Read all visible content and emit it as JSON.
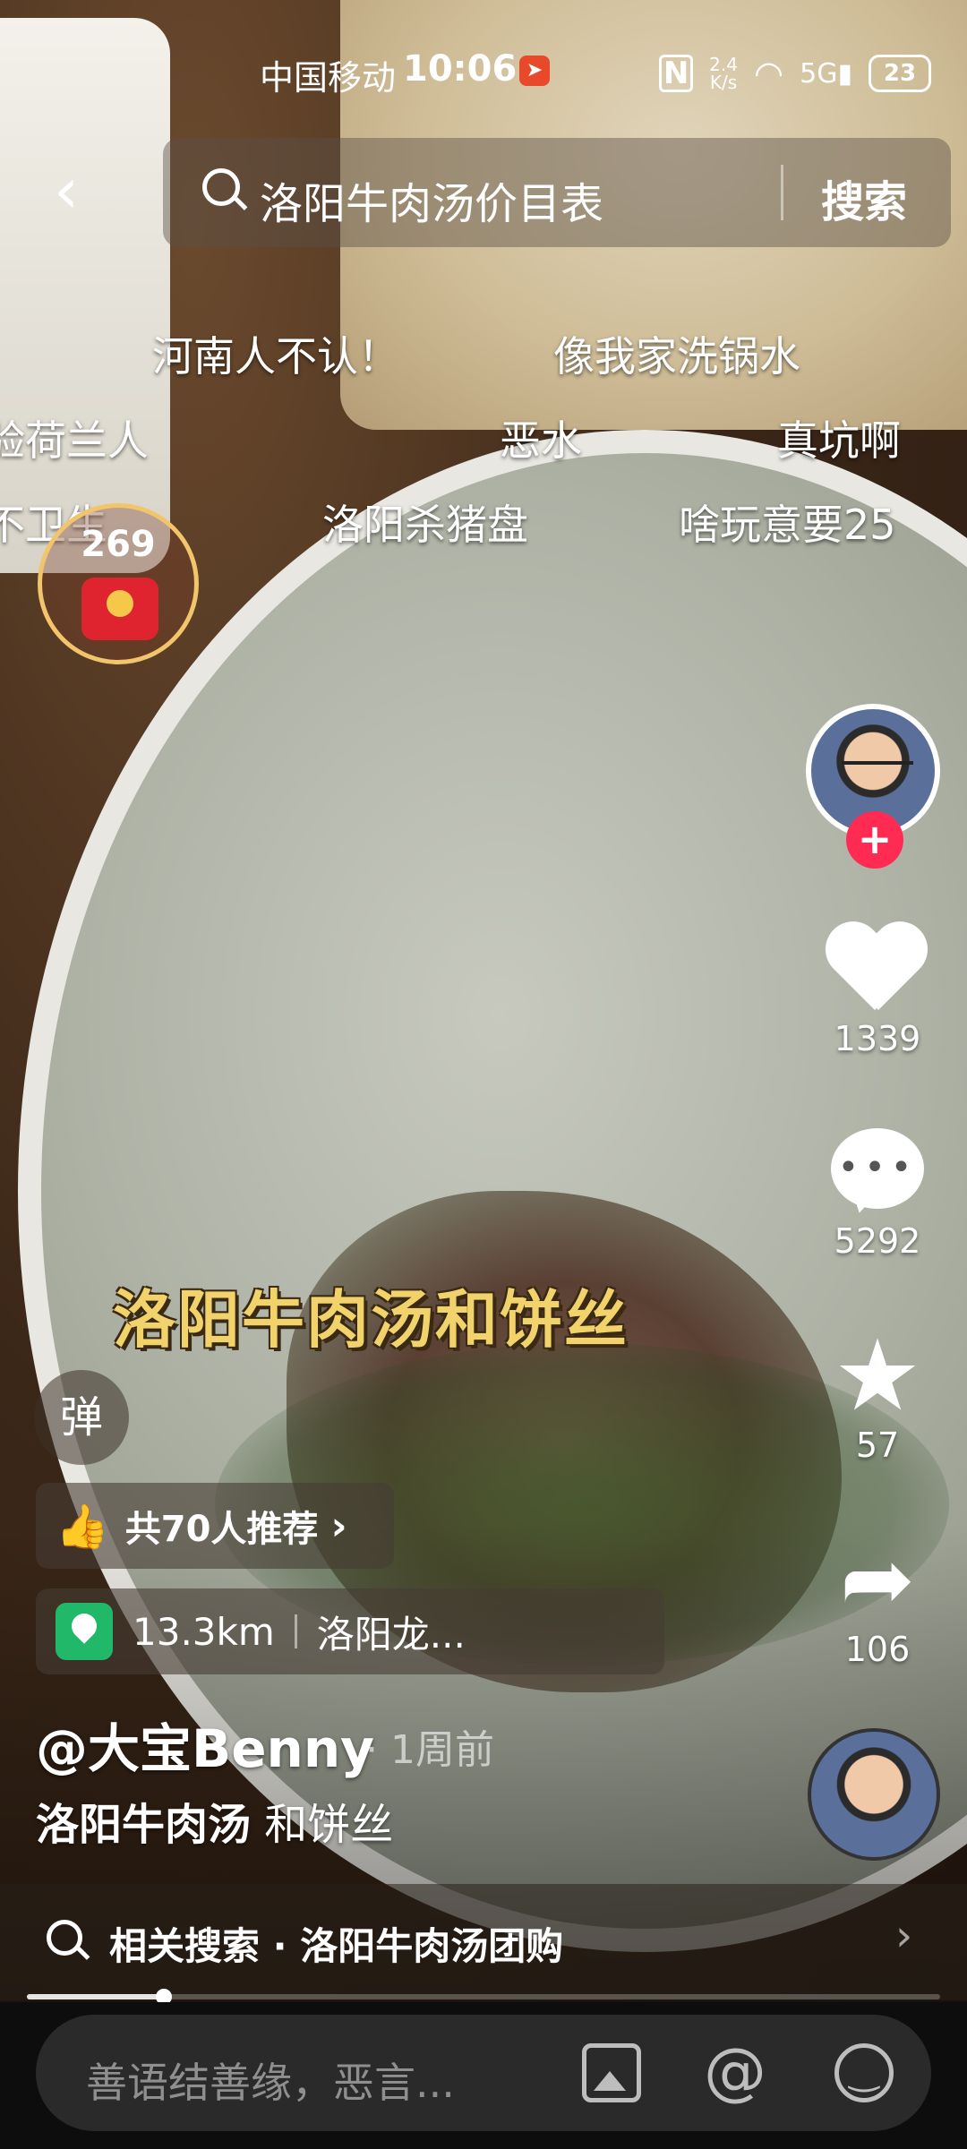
{
  "status_bar": {
    "carrier": "中国移动",
    "time": "10:06",
    "nfc": "N",
    "net_speed_value": "2.4",
    "net_speed_unit": "K/s",
    "signal": "5G",
    "battery": "23"
  },
  "search": {
    "query": "洛阳牛肉汤价目表",
    "button": "搜索"
  },
  "danmaku": [
    "河南人不认！",
    "像我家洗锅水",
    "验荷兰人",
    "恶水",
    "真坑啊",
    "不卫生",
    "洛阳杀猪盘",
    "啥玩意要25"
  ],
  "red_packet_count": "269",
  "actions": {
    "likes": "1339",
    "comments": "5292",
    "favorites": "57",
    "shares": "106"
  },
  "video_caption": "洛阳牛肉汤和饼丝",
  "danmu_toggle": "弹",
  "recommend": "共70人推荐",
  "location": {
    "distance": "13.3km",
    "name": "洛阳龙..."
  },
  "author": "@大宝Benny",
  "posted": "· 1周前",
  "description": {
    "tag": "洛阳牛肉汤",
    "rest": " 和饼丝"
  },
  "related_search": "相关搜索 · 洛阳牛肉汤团购",
  "progress": 0.15,
  "comment_placeholder": "善语结善缘，恶言..."
}
